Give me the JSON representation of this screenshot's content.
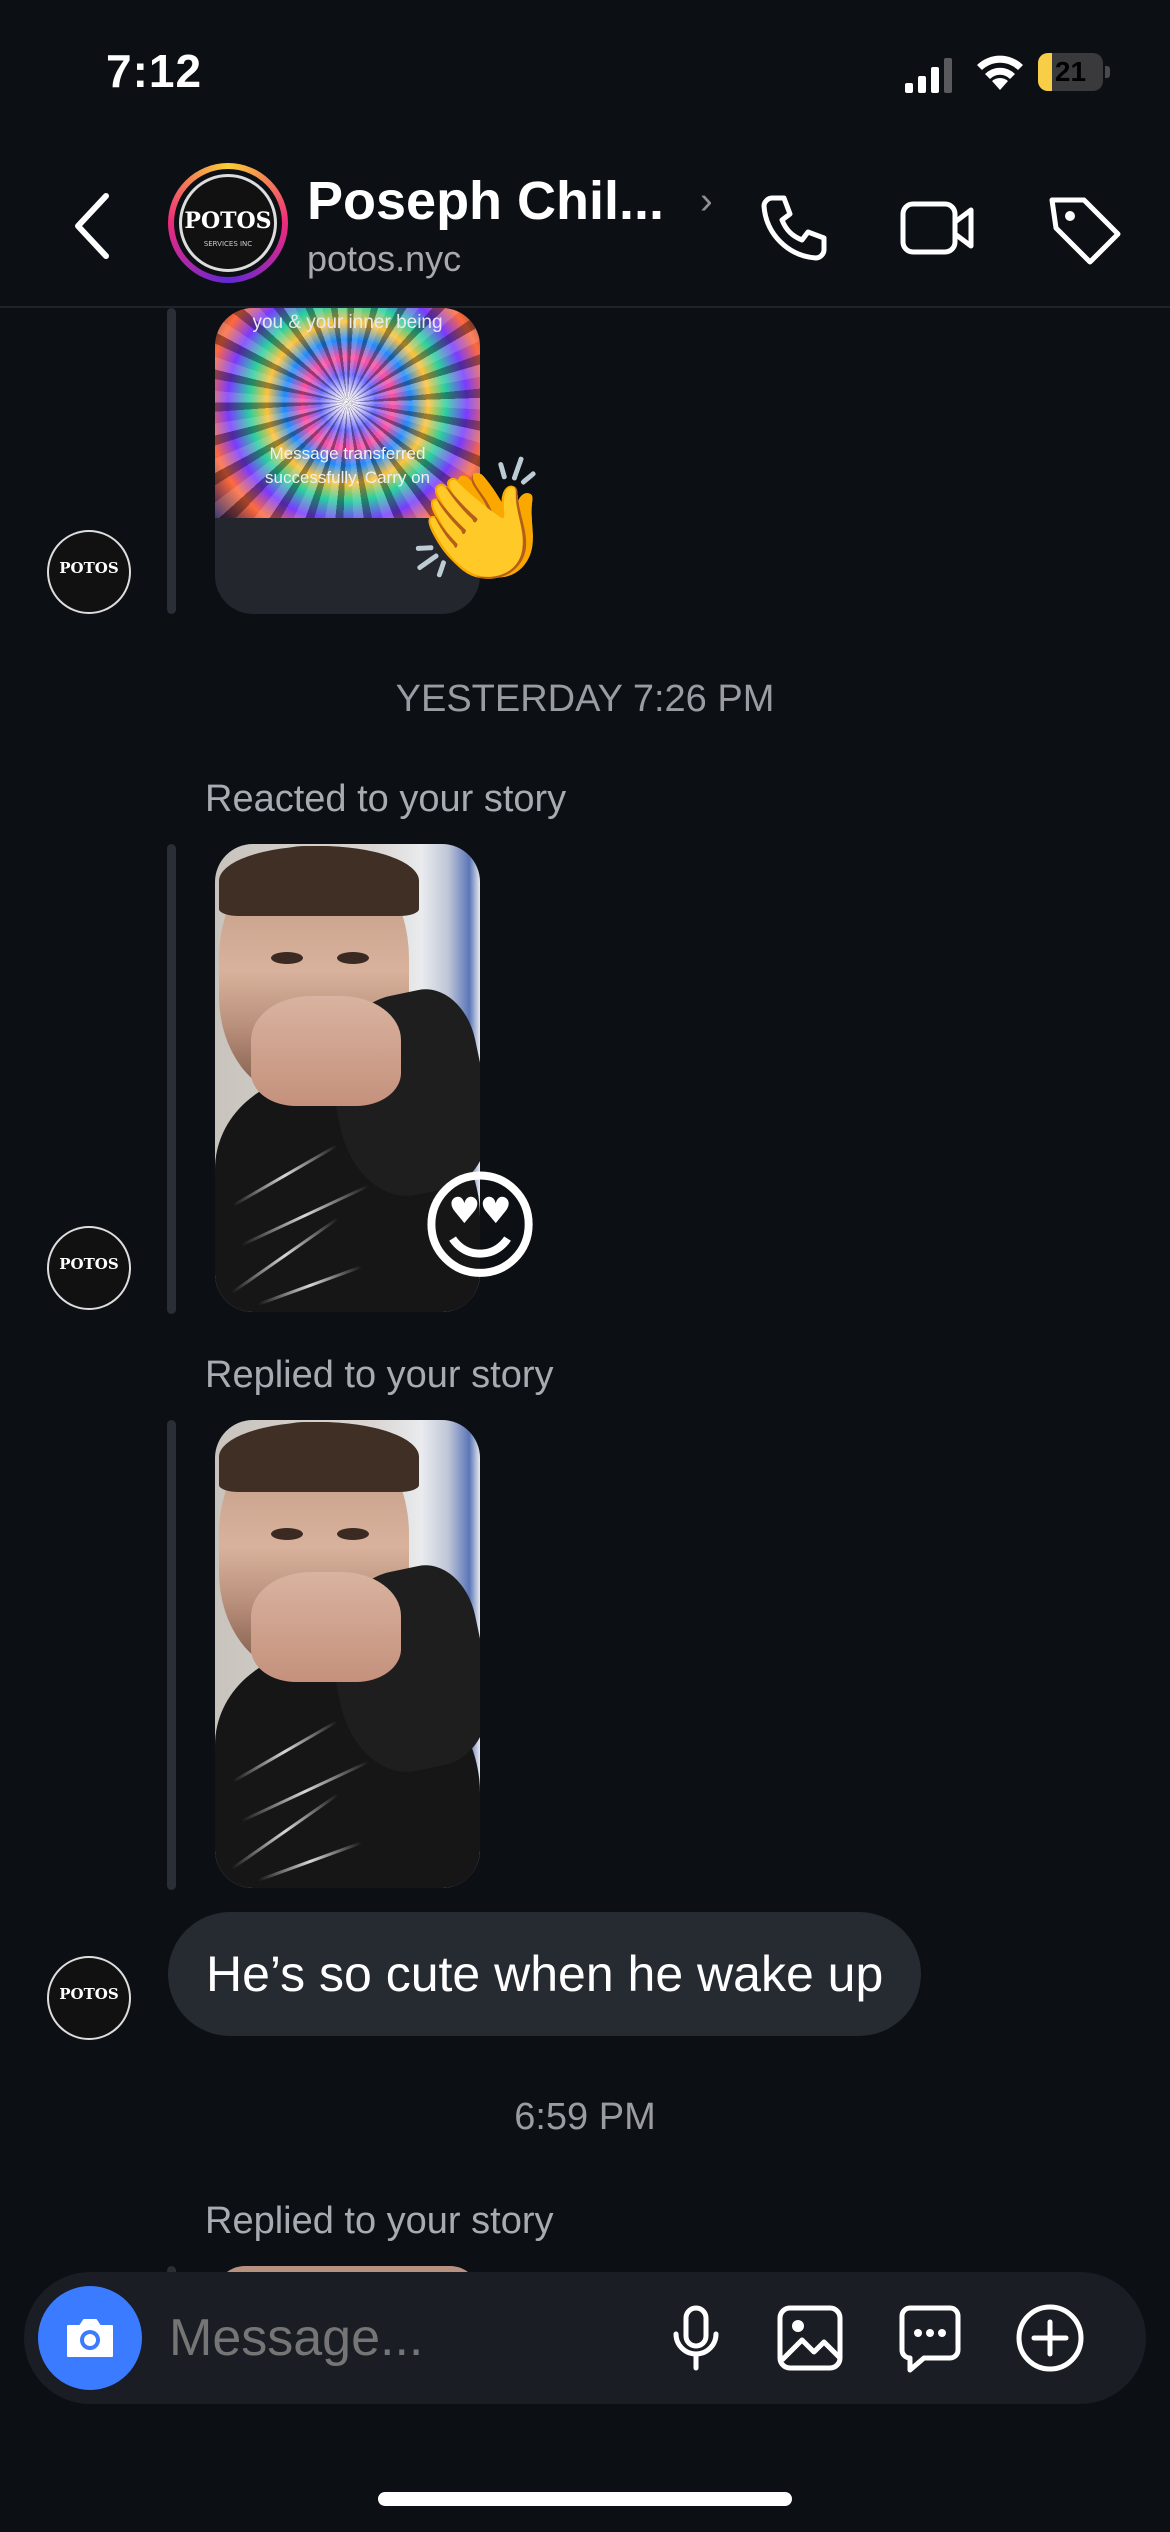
{
  "status_bar": {
    "time": "7:12",
    "battery_level": "21",
    "battery_fraction": 0.21,
    "battery_color": "#f7ce46",
    "icons": [
      "signal-icon",
      "wifi-icon",
      "battery-icon"
    ]
  },
  "header": {
    "contact_name": "Poseph Chil...",
    "username": "potos.nyc",
    "avatar_logo_text": "POTOS",
    "avatar_logo_subtext": "SERVICES INC",
    "icons": [
      "back-chevron-icon",
      "phone-icon",
      "video-camera-icon",
      "tag-icon"
    ]
  },
  "conversation": {
    "first_story": {
      "top_text": "you & your inner being",
      "bottom_text_line1": "Message transferred",
      "bottom_text_line2": "successfully. Carry on",
      "reaction_emoji": "👏"
    },
    "timestamp_1": "YESTERDAY 7:26 PM",
    "reacted_label": "Reacted to your story",
    "reacted_emoji": "😍",
    "replied_label_1": "Replied to your story",
    "message_text": "He’s so cute when he wake up",
    "timestamp_2": "6:59 PM",
    "replied_label_2": "Replied to your story"
  },
  "composer": {
    "placeholder": "Message...",
    "accent_color": "#3b7bff",
    "icons": [
      "camera-icon",
      "microphone-icon",
      "gallery-icon",
      "sticker-icon",
      "plus-circle-icon"
    ]
  }
}
